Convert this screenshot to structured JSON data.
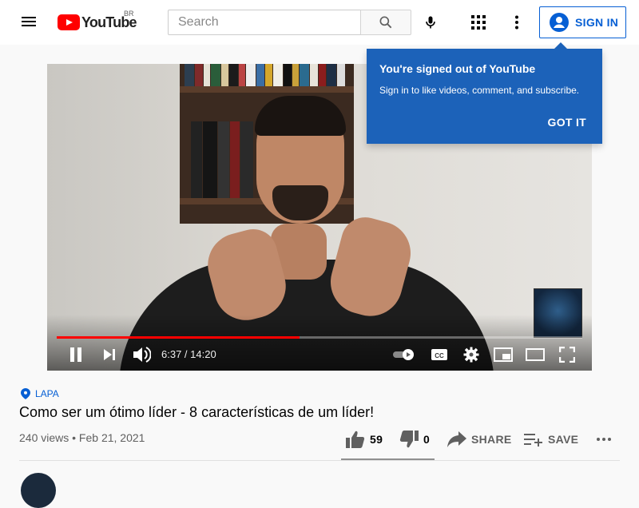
{
  "header": {
    "logo_text": "YouTube",
    "logo_region": "BR",
    "search_placeholder": "Search",
    "sign_in_label": "SIGN IN"
  },
  "popup": {
    "title": "You're signed out of YouTube",
    "text": "Sign in to like videos, comment, and subscribe.",
    "button_label": "GOT IT"
  },
  "player": {
    "current_time": "6:37",
    "duration": "14:20",
    "time_display": "6:37 / 14:20",
    "progress_fraction": 0.462,
    "progress_color": "#ff0000"
  },
  "video": {
    "location": "LAPA",
    "title": "Como ser um ótimo líder - 8 características de um líder!",
    "views": "240 views",
    "date": "Feb 21, 2021",
    "meta": "240 views • Feb 21, 2021"
  },
  "actions": {
    "like_count": "59",
    "dislike_count": "0",
    "share_label": "SHARE",
    "save_label": "SAVE"
  },
  "colors": {
    "brand_red": "#ff0000",
    "link_blue": "#065fd4",
    "popup_blue": "#1c62b9"
  }
}
